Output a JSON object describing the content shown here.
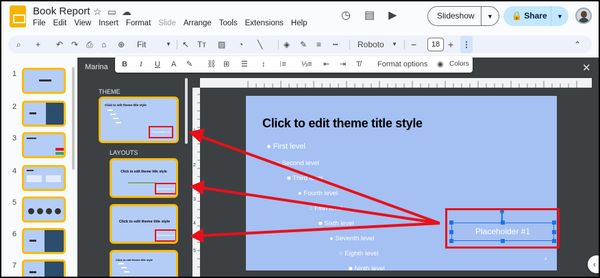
{
  "header": {
    "doc_title": "Book Report",
    "menu": [
      "File",
      "Edit",
      "View",
      "Insert",
      "Format",
      "Slide",
      "Arrange",
      "Tools",
      "Extensions",
      "Help"
    ],
    "slideshow_label": "Slideshow",
    "share_label": "Share"
  },
  "toolbar": {
    "zoom": "Fit",
    "font": "Roboto",
    "font_size": "18",
    "minus": "−",
    "plus": "+"
  },
  "format_bar": {
    "bold": "B",
    "italic": "I",
    "underline": "U",
    "text_color": "A",
    "format_options": "Format options",
    "colors": "Colors"
  },
  "filmstrip": {
    "slide_numbers": [
      "1",
      "2",
      "3",
      "4",
      "5",
      "6",
      "7"
    ]
  },
  "theme_panel": {
    "name": "Marina",
    "theme_label": "THEME",
    "layouts_label": "LAYOUTS",
    "theme_thumb_title": "Click to edit theme title style",
    "theme_thumb_placeholder": "Placeholder #1",
    "layout1_title": "Click to edit theme title style",
    "layout1_placeholder": "Placeholder #1",
    "layout2_title": "Click to edit theme title style",
    "layout2_placeholder": "Placeholder #1",
    "layout3_title": "Click to edit theme title style"
  },
  "ruler": {
    "v_labels": [
      "1",
      "2",
      "3",
      "4",
      "5"
    ]
  },
  "slide": {
    "title": "Click to edit theme title style",
    "levels": [
      "First level",
      "Second level",
      "Third level",
      "Fourth level",
      "Fifth level",
      "Sixth level",
      "Seventh level",
      "Eighth level",
      "Ninth level"
    ],
    "placeholder": "Placeholder #1",
    "page_mark": "#"
  },
  "colors": {
    "slide_bg": "#a5c0f2",
    "annotation_red": "#e8101a",
    "selection_blue": "#1a73e8",
    "thumb_border": "#fbbc04"
  }
}
